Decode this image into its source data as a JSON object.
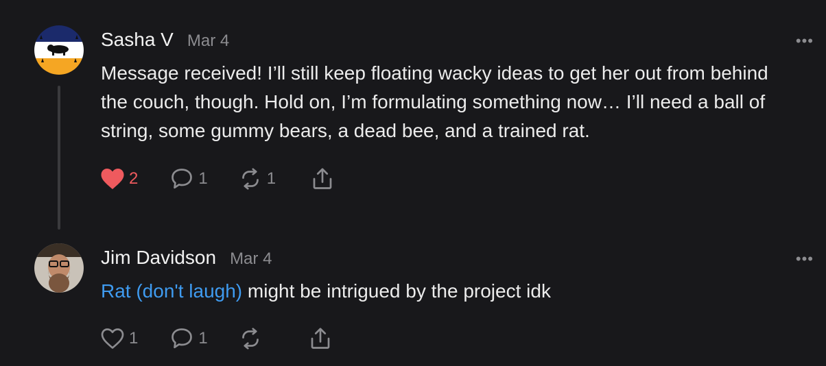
{
  "posts": [
    {
      "author": "Sasha V",
      "date": "Mar 4",
      "text": "Message received! I’ll still keep floating wacky ideas to get her out from behind the couch, though. Hold on, I’m formulating something now… I’ll need a ball of string, some gummy bears, a dead bee, and a trained rat.",
      "likes": "2",
      "liked": true,
      "replies": "1",
      "reposts": "1",
      "more": "•••"
    },
    {
      "author": "Jim Davidson",
      "date": "Mar 4",
      "mention": "Rat (don't laugh)",
      "text": " might be intrigued by the project idk",
      "likes": "1",
      "liked": false,
      "replies": "1",
      "reposts": "",
      "more": "•••"
    }
  ],
  "colors": {
    "background": "#18181b",
    "liked_heart": "#ef5a5e",
    "mention": "#3f9bf0",
    "muted": "#8c8c90"
  },
  "icons": [
    "heart-icon",
    "comment-icon",
    "repost-icon",
    "share-icon",
    "more-icon"
  ]
}
